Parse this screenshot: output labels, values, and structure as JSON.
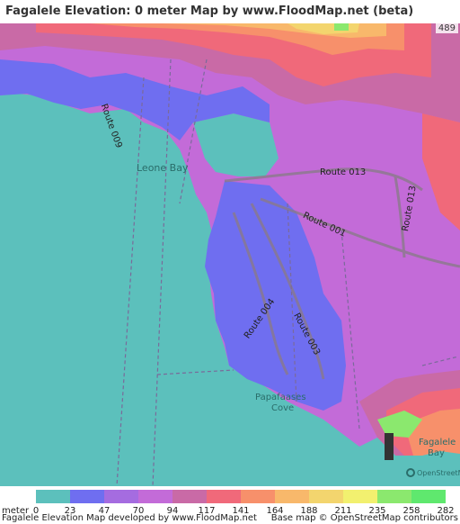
{
  "title": "Fagalele Elevation: 0 meter Map by www.FloodMap.net (beta)",
  "corner_elevation": "489",
  "labels": {
    "route_009": "Route 009",
    "leone_bay": "Leone Bay",
    "route_013_top": "Route 013",
    "route_001": "Route 001",
    "route_013_right": "Route 013",
    "route_004": "Route 004",
    "route_003": "Route 003",
    "papafaases_cove_1": "Papafaases",
    "papafaases_cove_2": "Cove",
    "fagalele_bay_1": "Fagalele",
    "fagalele_bay_2": "Bay",
    "osm_logo": "OpenStreetMap"
  },
  "legend": {
    "unit": "meter",
    "ticks": [
      "0",
      "23",
      "47",
      "70",
      "94",
      "117",
      "141",
      "164",
      "188",
      "211",
      "235",
      "258",
      "282"
    ],
    "colors": [
      "#5cc0bc",
      "#6f6ef0",
      "#a56ce0",
      "#c36bd8",
      "#c96aa6",
      "#f0697a",
      "#f7906b",
      "#f8b86b",
      "#f3d56e",
      "#f2f06f",
      "#8be86e",
      "#5fe86e"
    ]
  },
  "footer": {
    "left": "Fagalele Elevation Map developed by www.FloodMap.net",
    "right": "Base map © OpenStreetMap contributors"
  },
  "colors": {
    "sea": "#5cc0bc",
    "low": "#6f6ef0",
    "mid": "#a56ce0",
    "violet": "#c36bd8",
    "pink": "#c96aa6",
    "red": "#f0697a",
    "orange": "#f7906b",
    "amber": "#f8b86b",
    "yellow": "#f3d56e",
    "green": "#8be86e"
  }
}
